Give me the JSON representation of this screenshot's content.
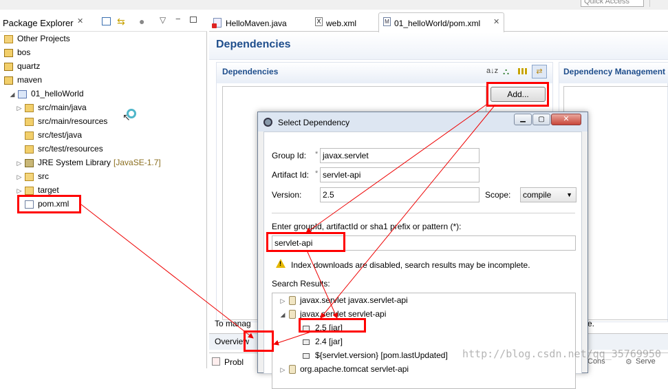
{
  "top": {
    "quick_access": "Quick Access"
  },
  "explorer": {
    "tab_label": "Package Explorer",
    "tree": [
      {
        "label": "Other Projects",
        "indent": 0,
        "icon": "working-set-icon"
      },
      {
        "label": "bos",
        "indent": 0,
        "icon": "project-icon"
      },
      {
        "label": "quartz",
        "indent": 0,
        "icon": "project-icon"
      },
      {
        "label": "maven",
        "indent": 0,
        "icon": "project-icon"
      },
      {
        "label": "01_helloWorld",
        "indent": 1,
        "icon": "maven-project-icon",
        "twisty": "expanded"
      },
      {
        "label": "src/main/java",
        "indent": 2,
        "icon": "source-folder-icon",
        "twisty": "collapsed"
      },
      {
        "label": "src/main/resources",
        "indent": 2,
        "icon": "source-folder-icon"
      },
      {
        "label": "src/test/java",
        "indent": 2,
        "icon": "source-folder-icon"
      },
      {
        "label": "src/test/resources",
        "indent": 2,
        "icon": "source-folder-icon"
      },
      {
        "label": "JRE System Library",
        "suffix": "[JavaSE-1.7]",
        "indent": 2,
        "icon": "library-icon",
        "twisty": "collapsed"
      },
      {
        "label": "src",
        "indent": 2,
        "icon": "folder-icon",
        "twisty": "collapsed"
      },
      {
        "label": "target",
        "indent": 2,
        "icon": "folder-icon",
        "twisty": "collapsed"
      },
      {
        "label": "pom.xml",
        "indent": 2,
        "icon": "maven-file-icon"
      }
    ]
  },
  "editor": {
    "tabs": [
      {
        "label": "HelloMaven.java",
        "icon": "java-file-icon"
      },
      {
        "label": "web.xml",
        "icon": "xml-file-icon"
      },
      {
        "label": "01_helloWorld/pom.xml",
        "icon": "maven-file-icon",
        "active": true
      }
    ],
    "header": "Dependencies",
    "dependencies_section": "Dependencies",
    "dep_mgmt_section": "Dependency Management",
    "add_button": "Add...",
    "to_manage_text": "To manag",
    "to_manage_end": "e.",
    "overview_tab": "Overview",
    "problems_tab": "Probl",
    "console_tab": "Cons",
    "servers_tab": "Serve"
  },
  "dialog": {
    "title": "Select Dependency",
    "group_id_label": "Group Id:",
    "group_id_value": "javax.servlet",
    "artifact_id_label": "Artifact Id:",
    "artifact_id_value": "servlet-api",
    "version_label": "Version:",
    "version_value": "2.5",
    "scope_label": "Scope:",
    "scope_value": "compile",
    "search_prompt": "Enter groupId, artifactId or sha1 prefix or pattern (*):",
    "search_value": "servlet-api",
    "warning": "Index downloads are disabled, search results may be incomplete.",
    "results_label": "Search Results:",
    "results": [
      {
        "label": "javax.servlet   javax.servlet-api",
        "level": 0,
        "twisty": "collapsed",
        "icon": "jar-icon"
      },
      {
        "label": "javax.servlet   servlet-api",
        "level": 0,
        "twisty": "expanded",
        "icon": "jar-icon"
      },
      {
        "label": "2.5 [jar]",
        "level": 1,
        "icon": "version-icon"
      },
      {
        "label": "2.4 [jar]",
        "level": 1,
        "icon": "version-icon"
      },
      {
        "label": "${servlet.version} [pom.lastUpdated]",
        "level": 1,
        "icon": "version-icon"
      },
      {
        "label": "org.apache.tomcat   servlet-api",
        "level": 0,
        "twisty": "collapsed",
        "icon": "jar-icon"
      }
    ]
  },
  "watermark": "http://blog.csdn.net/qq_35769950",
  "colors": {
    "accent": "#1f4e8c",
    "highlight": "#ff0000",
    "tabbar": "#e9eef6"
  }
}
